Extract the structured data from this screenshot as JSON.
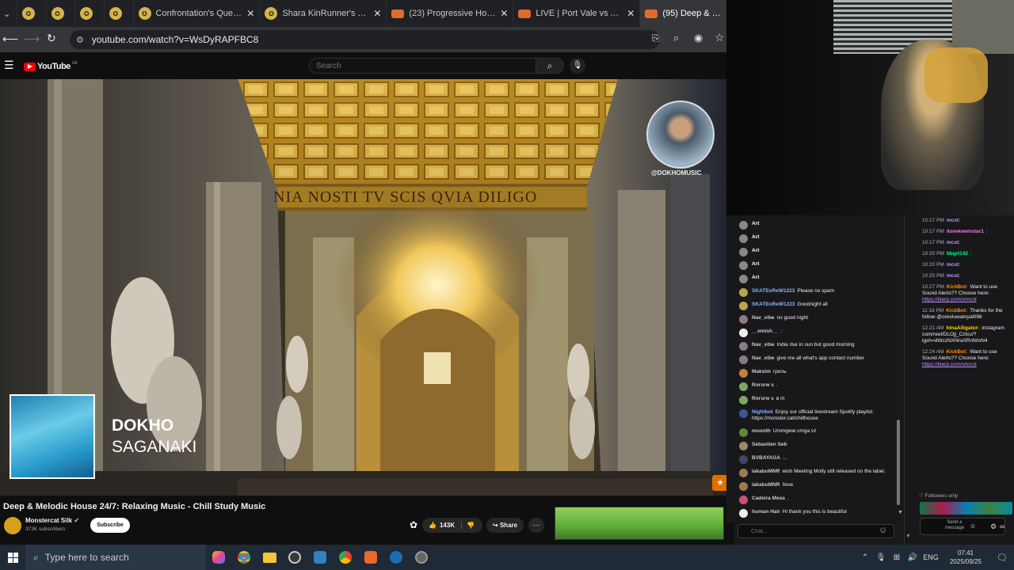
{
  "browser": {
    "tabs": [
      {
        "title": ""
      },
      {
        "title": ""
      },
      {
        "title": ""
      },
      {
        "title": ""
      },
      {
        "title": "Confrontation's Quests -"
      },
      {
        "title": "Shara KinRunner's Quest"
      },
      {
        "title": "(23) Progressive House 2"
      },
      {
        "title": "LIVE | Port Vale vs Arsena"
      },
      {
        "title": "(95) Deep & Melo"
      }
    ],
    "url": "youtube.com/watch?v=WsDyRAPFBC8"
  },
  "youtube": {
    "logo": "YouTube",
    "logo_country": "ZA",
    "search_placeholder": "Search",
    "video": {
      "inscription": "NIA NOSTI TV SCIS QVIA DILIGO",
      "channel_watermark": "@DOKHOMUSIC",
      "track_artist": "DOKHO",
      "track_name": "SAGANAKI",
      "title": "Deep & Melodic House 24/7: Relaxing Music - Chill Study Music",
      "channel": "Monstercat Silk",
      "subscribers": "373K subscribers",
      "subscribe_label": "Subscribe",
      "likes": "143K",
      "share_label": "Share"
    }
  },
  "chat": {
    "messages": [
      {
        "user": "Art",
        "text": "",
        "color": "#ffffff",
        "avatar": "#888888"
      },
      {
        "user": "Art",
        "text": "",
        "color": "#ffffff",
        "avatar": "#888888"
      },
      {
        "user": "Art",
        "text": "",
        "color": "#ffffff",
        "avatar": "#888888"
      },
      {
        "user": "Art",
        "text": "",
        "color": "#ffffff",
        "avatar": "#888888"
      },
      {
        "user": "Art",
        "text": "",
        "color": "#ffffff",
        "avatar": "#888888"
      },
      {
        "user": "SKATEoReW1223",
        "text": "Please no spam",
        "color": "#8ab4ff",
        "avatar": "#b8a44b"
      },
      {
        "user": "SKATEoReW1223",
        "text": "Goodnight all",
        "color": "#8ab4ff",
        "avatar": "#b8a44b"
      },
      {
        "user": "Nav_vibe",
        "text": "no good night",
        "color": "#cccccc",
        "avatar": "#8a7a8a"
      },
      {
        "user": "__emish__",
        "text": ":",
        "color": "#cccccc",
        "avatar": "#eeeeee"
      },
      {
        "user": "Nav_vibe",
        "text": "India rise in sun but good morning",
        "color": "#cccccc",
        "avatar": "#8a7a8a"
      },
      {
        "user": "Nav_vibe",
        "text": "give me all what's app contact number",
        "color": "#cccccc",
        "avatar": "#8a7a8a"
      },
      {
        "user": "Maksim",
        "text": "гриль",
        "color": "#cccccc",
        "avatar": "#c08040"
      },
      {
        "user": "Rorsrw s",
        "text": ".",
        "color": "#cccccc",
        "avatar": "#7aa860"
      },
      {
        "user": "Rorsrw s",
        "text": "в m",
        "color": "#cccccc",
        "avatar": "#7aa860"
      },
      {
        "user": "Nightbot",
        "text": "Enjoy our official livestream Spotify playlist: https://monster.cat/chillhouse",
        "color": "#8ab4ff",
        "avatar": "#3a5a8a"
      },
      {
        "user": "moonth",
        "text": "Ummgww cmga vz",
        "color": "#cccccc",
        "avatar": "#5a8a3a"
      },
      {
        "user": "Sebastien Seb",
        "text": "",
        "color": "#cccccc",
        "avatar": "#9a8a6a"
      },
      {
        "user": "BVBAYAGA",
        "text": "...",
        "color": "#cccccc",
        "avatar": "#444466"
      },
      {
        "user": "lakaboMNR",
        "text": "wish Meeting Molly still released on the label.",
        "color": "#cccccc",
        "avatar": "#a07850"
      },
      {
        "user": "lakaboMNR",
        "text": "!love",
        "color": "#cccccc",
        "avatar": "#a07850"
      },
      {
        "user": "Cadeira Mesa",
        "text": ".",
        "color": "#cccccc",
        "avatar": "#d05070"
      },
      {
        "user": "human Hair",
        "text": "Hi thank you this is beautiful",
        "color": "#cccccc",
        "avatar": "#eeeeee"
      }
    ],
    "input_placeholder": "Chat..."
  },
  "events": {
    "items": [
      {
        "time": "10:17 PM",
        "user": "mcst:",
        "text": "",
        "color": "#bf94ff"
      },
      {
        "time": "10:17 PM",
        "user": "ilovekeemstar1",
        "text": ":",
        "color": "#ff75e6"
      },
      {
        "time": "10:17 PM",
        "user": "mcst:",
        "text": "",
        "color": "#bf94ff"
      },
      {
        "time": "10:20 PM",
        "user": "bbgrl143",
        "text": ":",
        "color": "#00ff7f"
      },
      {
        "time": "10:20 PM",
        "user": "mcst:",
        "text": "",
        "color": "#bf94ff"
      },
      {
        "time": "10:20 PM",
        "user": "mcst:",
        "text": "",
        "color": "#bf94ff"
      },
      {
        "time": "10:27 PM",
        "user": "KickBot:",
        "text": "Want to use Sound Alerts?? Choose here:",
        "link": "https://bierp.com/x/mcst",
        "color": "#ff8c00"
      },
      {
        "time": "11:18 PM",
        "user": "KickBot:",
        "text": "Thanks for the follow @oreoluwaloyal096",
        "color": "#ff8c00"
      },
      {
        "time": "12:21 AM",
        "user": "hlnaAlligator:",
        "text": "instagram com/reel/DLOjj_Czlcu/? igsh=dWczNXNraXRnNmN4",
        "color": "#ffd700"
      },
      {
        "time": "12:24 AM",
        "user": "KickBot:",
        "text": "Want to use Sound Alerts?? Choose here:",
        "link": "https://bierp.com/x/mcst",
        "color": "#ff8c00"
      }
    ],
    "followers_only": "Followers only",
    "send_label": "Send a message"
  },
  "taskbar": {
    "search_placeholder": "Type here to search",
    "lang": "ENG",
    "time": "07:41",
    "date": "2025/09/25"
  }
}
